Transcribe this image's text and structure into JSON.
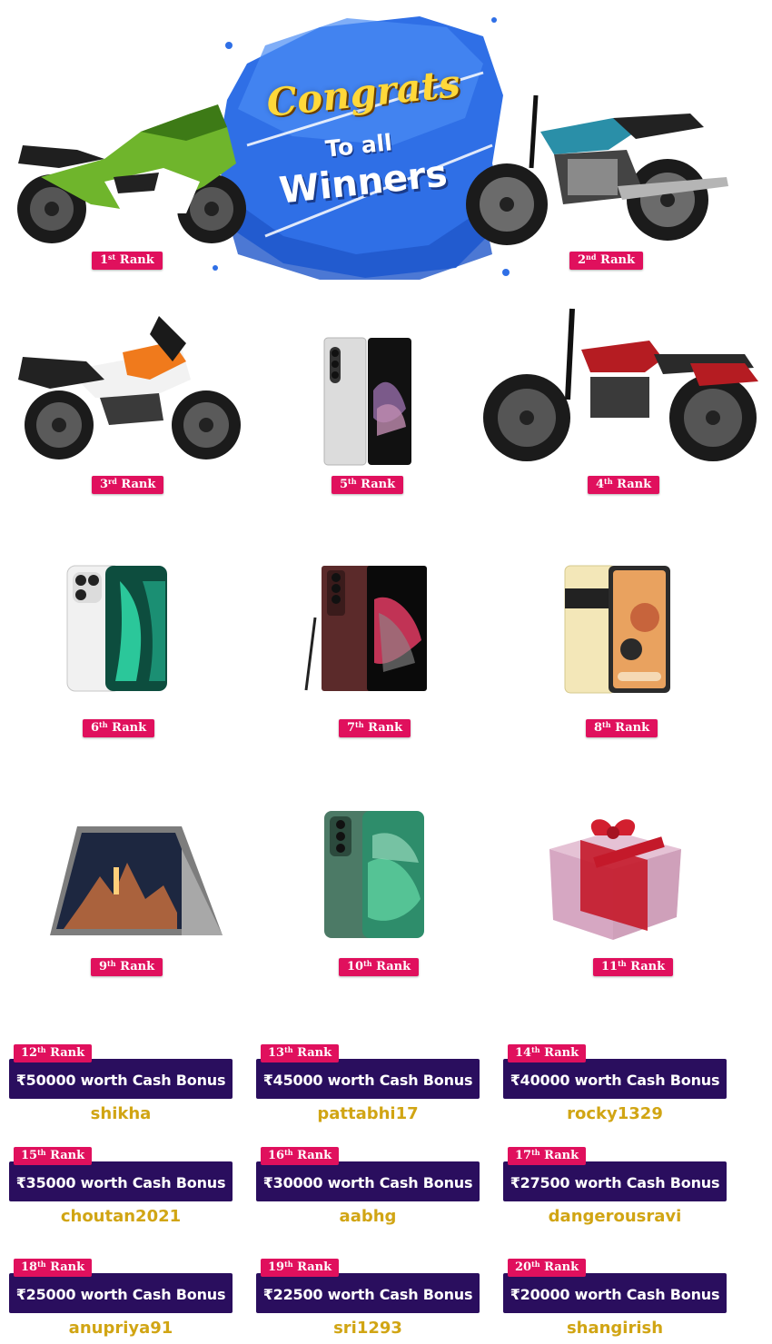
{
  "banner": {
    "line1": "Congrats",
    "line2": "To all",
    "line3": "Winners"
  },
  "rank_word": "Rank",
  "prizes": [
    {
      "num": "1",
      "sup": "st",
      "image": "green-sport-motorcycle"
    },
    {
      "num": "2",
      "sup": "nd",
      "image": "blue-cafe-racer-motorcycle"
    },
    {
      "num": "3",
      "sup": "rd",
      "image": "orange-adventure-motorcycle"
    },
    {
      "num": "5",
      "sup": "th",
      "image": "foldable-phone"
    },
    {
      "num": "4",
      "sup": "th",
      "image": "red-classic-motorcycle"
    },
    {
      "num": "6",
      "sup": "th",
      "image": "iphone"
    },
    {
      "num": "7",
      "sup": "th",
      "image": "samsung-galaxy-phone"
    },
    {
      "num": "8",
      "sup": "th",
      "image": "pixel-phone"
    },
    {
      "num": "9",
      "sup": "th",
      "image": "convertible-laptop"
    },
    {
      "num": "10",
      "sup": "th",
      "image": "oneplus-phone"
    },
    {
      "num": "11",
      "sup": "th",
      "image": "cash-gift-box"
    }
  ],
  "bonuses": [
    {
      "num": "12",
      "sup": "th",
      "label": "₹50000 worth Cash Bonus",
      "winner": "shikha"
    },
    {
      "num": "13",
      "sup": "th",
      "label": "₹45000 worth Cash Bonus",
      "winner": "pattabhi17"
    },
    {
      "num": "14",
      "sup": "th",
      "label": "₹40000 worth Cash Bonus",
      "winner": "rocky1329"
    },
    {
      "num": "15",
      "sup": "th",
      "label": "₹35000 worth Cash Bonus",
      "winner": "choutan2021"
    },
    {
      "num": "16",
      "sup": "th",
      "label": "₹30000 worth Cash Bonus",
      "winner": "aabhg"
    },
    {
      "num": "17",
      "sup": "th",
      "label": "₹27500 worth Cash Bonus",
      "winner": "dangerousravi"
    },
    {
      "num": "18",
      "sup": "th",
      "label": "₹25000 worth Cash Bonus",
      "winner": "anupriya91"
    },
    {
      "num": "19",
      "sup": "th",
      "label": "₹22500 worth Cash Bonus",
      "winner": "sri1293"
    },
    {
      "num": "20",
      "sup": "th",
      "label": "₹20000 worth Cash Bonus",
      "winner": "shangirish"
    }
  ],
  "colors": {
    "rank_tag": "#e0105d",
    "bonus_bar": "#2a0e5e",
    "winner_name": "#d1a514",
    "splash": "#2f6fe6",
    "congrats_text": "#ffd83a"
  }
}
